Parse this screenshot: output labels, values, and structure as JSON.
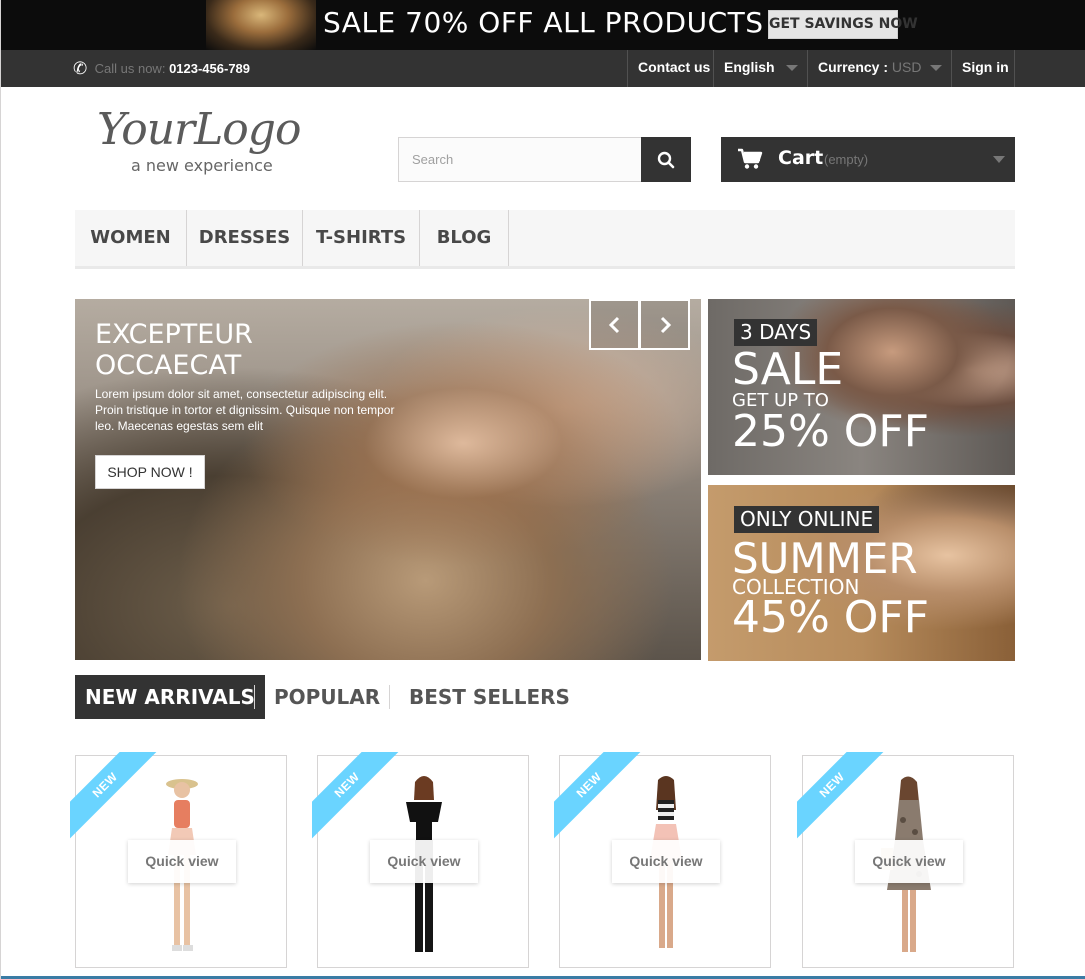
{
  "promo": {
    "text": "SALE 70% OFF ALL PRODUCTS",
    "button": "GET SAVINGS NOW"
  },
  "topbar": {
    "call_label": "Call us now:",
    "phone": "0123-456-789",
    "contact": "Contact us",
    "language": "English",
    "currency_label": "Currency :",
    "currency_value": "USD",
    "signin": "Sign in"
  },
  "logo": {
    "name": "YourLogo",
    "tagline": "a new experience"
  },
  "search": {
    "placeholder": "Search"
  },
  "cart": {
    "label": "Cart",
    "status": "(empty)"
  },
  "menu": [
    "WOMEN",
    "DRESSES",
    "T-SHIRTS",
    "BLOG"
  ],
  "hero": {
    "title": "EXCEPTEUR OCCAECAT",
    "text": "Lorem ipsum dolor sit amet, consectetur adipiscing elit. Proin tristique in tortor et dignissim. Quisque non tempor leo. Maecenas egestas sem elit",
    "button": "SHOP NOW !"
  },
  "banners": [
    {
      "tag": "3 DAYS",
      "big": "SALE",
      "sub": "GET UP TO",
      "offer": "25% OFF"
    },
    {
      "tag": "ONLY ONLINE",
      "big": "SUMMER",
      "sub": "COLLECTION",
      "offer": "45% OFF"
    }
  ],
  "tabs": [
    "NEW ARRIVALS",
    "POPULAR",
    "BEST SELLERS"
  ],
  "products": [
    {
      "badge": "NEW",
      "quickview": "Quick view"
    },
    {
      "badge": "NEW",
      "quickview": "Quick view"
    },
    {
      "badge": "NEW",
      "quickview": "Quick view"
    },
    {
      "badge": "NEW",
      "quickview": "Quick view"
    }
  ],
  "colors": {
    "dark": "#333333",
    "ribbon": "#6ad4ff",
    "menu_bg": "#f6f6f6"
  }
}
